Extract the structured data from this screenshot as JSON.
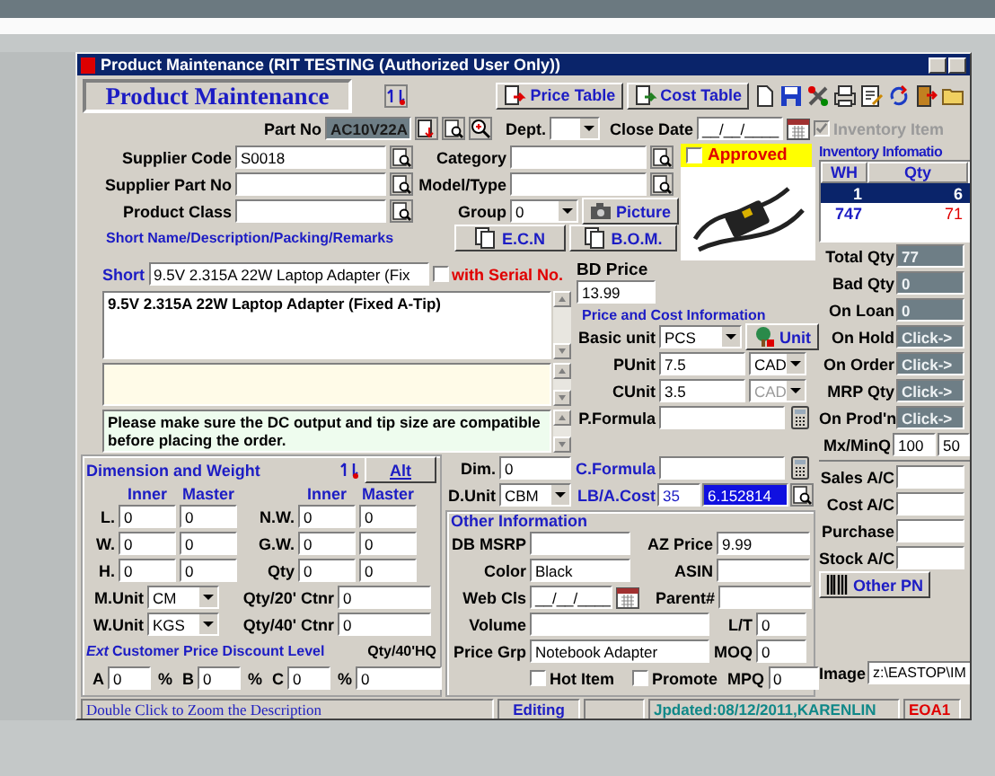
{
  "window": {
    "title": "Product Maintenance (RIT TESTING (Authorized User Only))"
  },
  "header": {
    "title": "Product Maintenance"
  },
  "toolbar_buttons": [
    "Price Table",
    "Cost Table"
  ],
  "part": {
    "label": "Part No",
    "value": "AC10V22A"
  },
  "dept": {
    "label": "Dept."
  },
  "close_date": {
    "label": "Close Date",
    "value": "__/__/____"
  },
  "inventory_item": {
    "label": "Inventory Item",
    "checked": true,
    "disabled": true
  },
  "supplier_fields": [
    {
      "label": "Supplier Code",
      "value": "S0018"
    },
    {
      "label": "Supplier Part No"
    },
    {
      "label": "Product Class"
    }
  ],
  "category_fields": [
    {
      "label": "Category"
    },
    {
      "label": "Model/Type"
    },
    {
      "label": "Group",
      "value": "0"
    }
  ],
  "picture_button": "Picture",
  "approved": {
    "label": "Approved",
    "checked": false
  },
  "description": {
    "legend": "Short Name/Description/Packing/Remarks",
    "short_label": "Short",
    "short_value": "9.5V 2.315A 22W Laptop Adapter (Fix",
    "with_serial": {
      "label": "with Serial No.",
      "checked": false
    },
    "text": "9.5V 2.315A 22W Laptop Adapter (Fixed A-Tip)",
    "remarks": "Please make sure the DC output and tip size are compatible before placing the order."
  },
  "ecn_button": "E.C.N",
  "bom_button": "B.O.M.",
  "bd_price": {
    "label": "BD Price",
    "value": "13.99"
  },
  "price_cost": {
    "legend": "Price and Cost Information",
    "basic_unit": {
      "label": "Basic unit",
      "value": "PCS"
    },
    "unit_button": "Unit",
    "punit": {
      "label": "PUnit",
      "value": "7.5",
      "currency": "CAD",
      "currency_disabled": false
    },
    "cunit": {
      "label": "CUnit",
      "value": "3.5",
      "currency": "CAD",
      "currency_disabled": true
    },
    "p_formula": {
      "label": "P.Formula"
    },
    "c_formula": {
      "label": "C.Formula"
    },
    "lb_cost": {
      "label": "LB/A.Cost",
      "value": "35",
      "value_2": "6.152814"
    }
  },
  "dimension": {
    "legend": "Dimension and Weight",
    "alt_button": "Alt",
    "columns": [
      "Inner",
      "Master",
      "Inner",
      "Master"
    ],
    "rows": [
      {
        "label": "L.",
        "inner": "0",
        "master": "0",
        "label_2": "N.W.",
        "inner_2": "0",
        "master_2": "0"
      },
      {
        "label": "W.",
        "inner": "0",
        "master": "0",
        "label_2": "G.W.",
        "inner_2": "0",
        "master_2": "0"
      },
      {
        "label": "H.",
        "inner": "0",
        "master": "0",
        "label_2": "Qty",
        "inner_2": "0",
        "master_2": "0"
      }
    ],
    "m_unit": {
      "label": "M.Unit",
      "value": "CM"
    },
    "w_unit": {
      "label": "W.Unit",
      "value": "KGS"
    },
    "ctnr": [
      {
        "label": "Qty/20' Ctnr",
        "value": "0"
      },
      {
        "label": "Qty/40' Ctnr",
        "value": "0"
      },
      {
        "label": "Qty/40'HQ",
        "value": "0"
      }
    ]
  },
  "dim": {
    "label": "Dim.",
    "value": "0"
  },
  "d_unit": {
    "label": "D.Unit",
    "value": "CBM"
  },
  "ext_label": "Ext",
  "discount": {
    "legend": "Customer Price Discount Level",
    "levels": [
      {
        "label": "A",
        "value": "0",
        "unit": "%"
      },
      {
        "label": "B",
        "value": "0",
        "unit": "%"
      },
      {
        "label": "C",
        "value": "0",
        "unit": "%"
      }
    ]
  },
  "other_info": {
    "legend": "Other Information",
    "db_msrp": {
      "label": "DB MSRP"
    },
    "az_price": {
      "label": "AZ Price",
      "value": "9.99"
    },
    "color": {
      "label": "Color",
      "value": "Black"
    },
    "asin": {
      "label": "ASIN"
    },
    "web_cls": {
      "label": "Web Cls",
      "value": "__/__/____"
    },
    "parent": {
      "label": "Parent#"
    },
    "volume": {
      "label": "Volume"
    },
    "lt": {
      "label": "L/T",
      "value": "0"
    },
    "price_grp": {
      "label": "Price Grp",
      "value": "Notebook Adapter"
    },
    "moq": {
      "label": "MOQ",
      "value": "0"
    },
    "hot_item": {
      "label": "Hot Item",
      "checked": false
    },
    "promote": {
      "label": "Promote",
      "checked": false
    },
    "mpq": {
      "label": "MPQ",
      "value": "0"
    }
  },
  "inventory": {
    "legend": "Inventory Infomatio",
    "columns": [
      "WH",
      "Qty"
    ],
    "rows": [
      {
        "wh": "1",
        "qty": "6",
        "selected": true
      },
      {
        "wh": "747",
        "qty": "71",
        "selected": false
      }
    ],
    "stats": [
      {
        "label": "Total Qty",
        "value": "77"
      },
      {
        "label": "Bad Qty",
        "value": "0"
      },
      {
        "label": "On Loan",
        "value": "0"
      },
      {
        "label": "On Hold",
        "value": "Click->"
      },
      {
        "label": "On Order",
        "value": "Click->"
      },
      {
        "label": "MRP Qty",
        "value": "Click->"
      },
      {
        "label": "On Prod'n",
        "value": "Click->"
      }
    ],
    "minmax": {
      "label": "Mx/MinQ",
      "values": [
        "100",
        "50"
      ]
    },
    "accounts": [
      {
        "label": "Sales A/C"
      },
      {
        "label": "Cost A/C"
      },
      {
        "label": "Purchase"
      },
      {
        "label": "Stock A/C"
      }
    ],
    "other_pn_button": "Other PN",
    "image": {
      "label": "Image",
      "value": "z:\\EASTOP\\IM"
    }
  },
  "status_bar": {
    "hint": "Double Click to Zoom the Description",
    "mode": "Editing",
    "updated": "Jpdated:08/12/2011,KARENLIN",
    "code": "EOA1"
  }
}
